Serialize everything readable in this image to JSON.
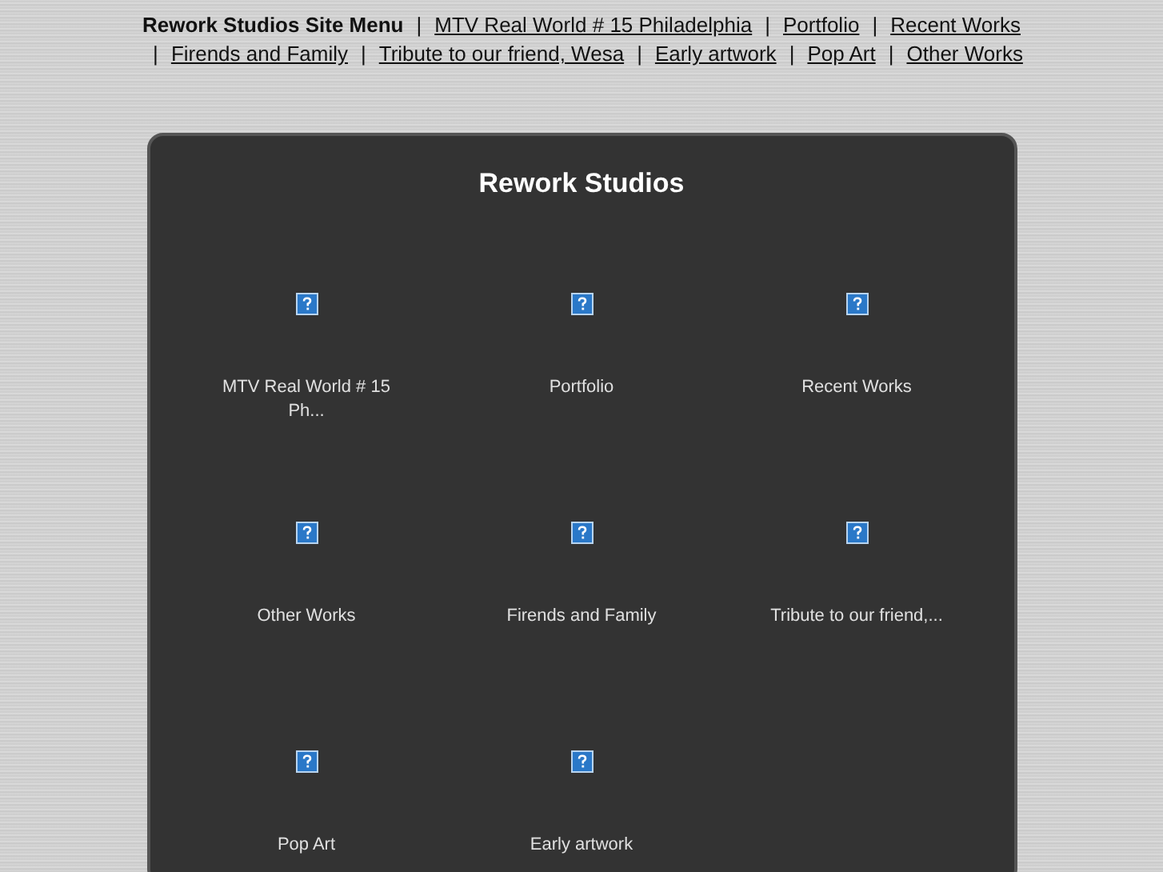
{
  "menu": {
    "title": "Rework Studios Site Menu",
    "separator": "|",
    "lines": [
      [
        "MTV Real World # 15 Philadelphia",
        "Portfolio",
        "Recent Works"
      ],
      [
        "Firends and Family",
        "Tribute to our friend, Wesa",
        "Early artwork",
        "Pop Art",
        "Other Works"
      ]
    ]
  },
  "panel": {
    "title": "Rework Studios",
    "items": [
      {
        "label": "MTV Real World # 15 Ph..."
      },
      {
        "label": "Portfolio"
      },
      {
        "label": "Recent Works"
      },
      {
        "label": "Other Works"
      },
      {
        "label": "Firends and Family"
      },
      {
        "label": "Tribute to our friend,..."
      },
      {
        "label": "Pop Art"
      },
      {
        "label": "Early artwork"
      }
    ]
  }
}
